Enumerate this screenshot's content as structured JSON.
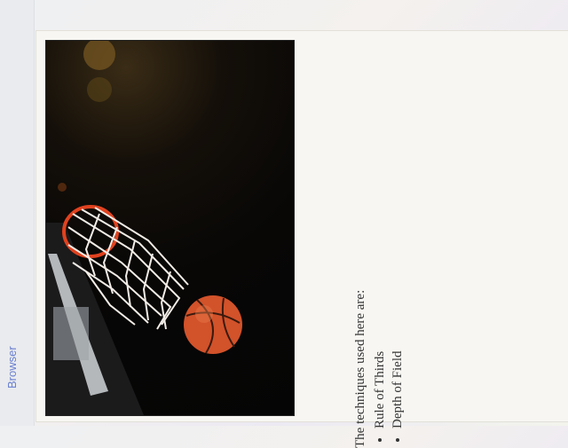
{
  "sidebar": {
    "label": "Browser"
  },
  "content": {
    "photo_alt": "basketball-photo",
    "intro": "The techniques used here are:",
    "techniques": [
      "Rule of Thirds",
      "Depth of Field"
    ]
  },
  "colors": {
    "accent": "#6a7fd0",
    "ball": "#d2522a",
    "net": "#f2ece6"
  }
}
